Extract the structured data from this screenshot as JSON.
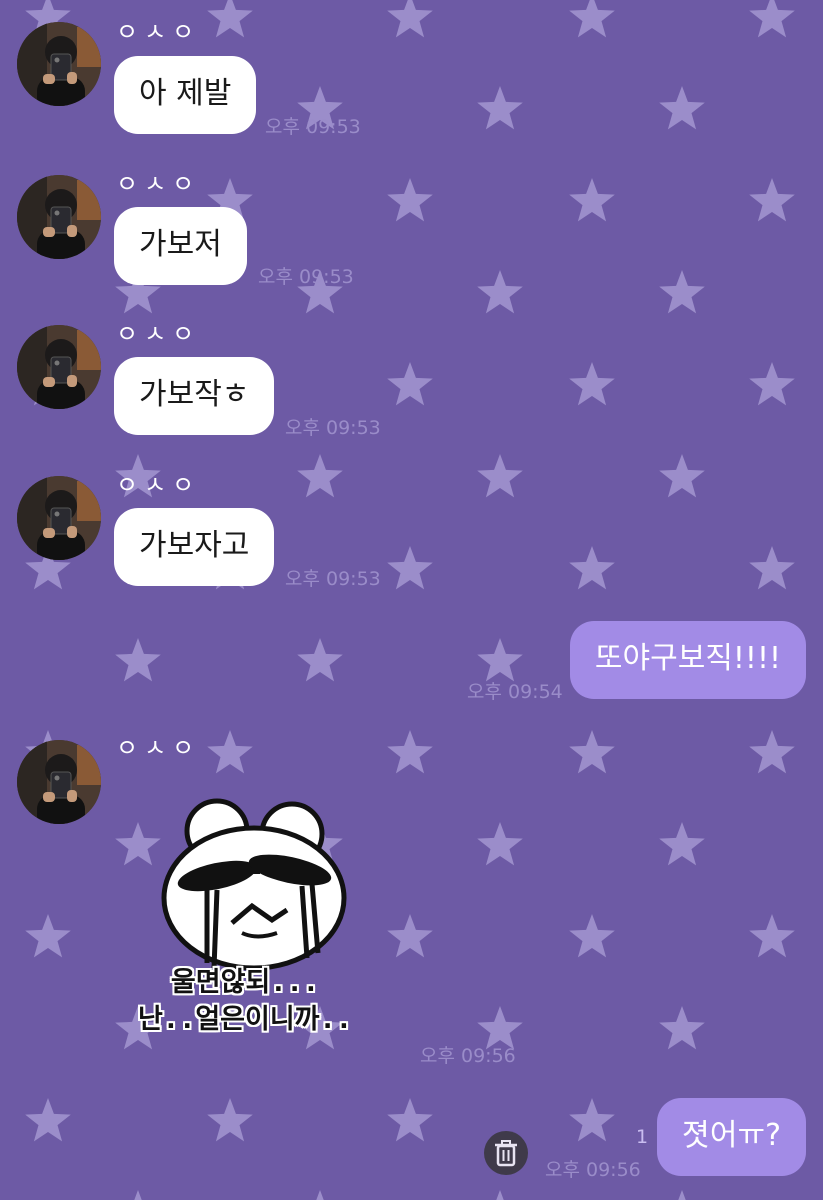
{
  "colors": {
    "background": "#6d5aa5",
    "star": "#a396d0",
    "received_bubble": "#ffffff",
    "sent_bubble": "#a28be6",
    "timestamp": "#9a8cc9"
  },
  "contact": {
    "name": "ㅇㅅㅇ",
    "avatar_icon": "profile-photo"
  },
  "messages": [
    {
      "sender": "contact",
      "text": "아 제발",
      "time": "오후 09:53"
    },
    {
      "sender": "contact",
      "text": "가보저",
      "time": "오후 09:53"
    },
    {
      "sender": "contact",
      "text": "가보작ㅎ",
      "time": "오후 09:53"
    },
    {
      "sender": "contact",
      "text": "가보자고",
      "time": "오후 09:53"
    },
    {
      "sender": "me",
      "text": "또야구보직!!!!",
      "time": "오후 09:54"
    },
    {
      "sender": "contact",
      "type": "sticker",
      "sticker_caption_1": "울면않되...",
      "sticker_caption_2": "난..얼은이니까..",
      "time": "오후 09:56"
    },
    {
      "sender": "me",
      "text": "졋어ㅠ?",
      "time": "오후 09:56",
      "unread_count": "1"
    }
  ],
  "icons": {
    "delete": "trash-icon",
    "background_pattern": "star-icon"
  }
}
